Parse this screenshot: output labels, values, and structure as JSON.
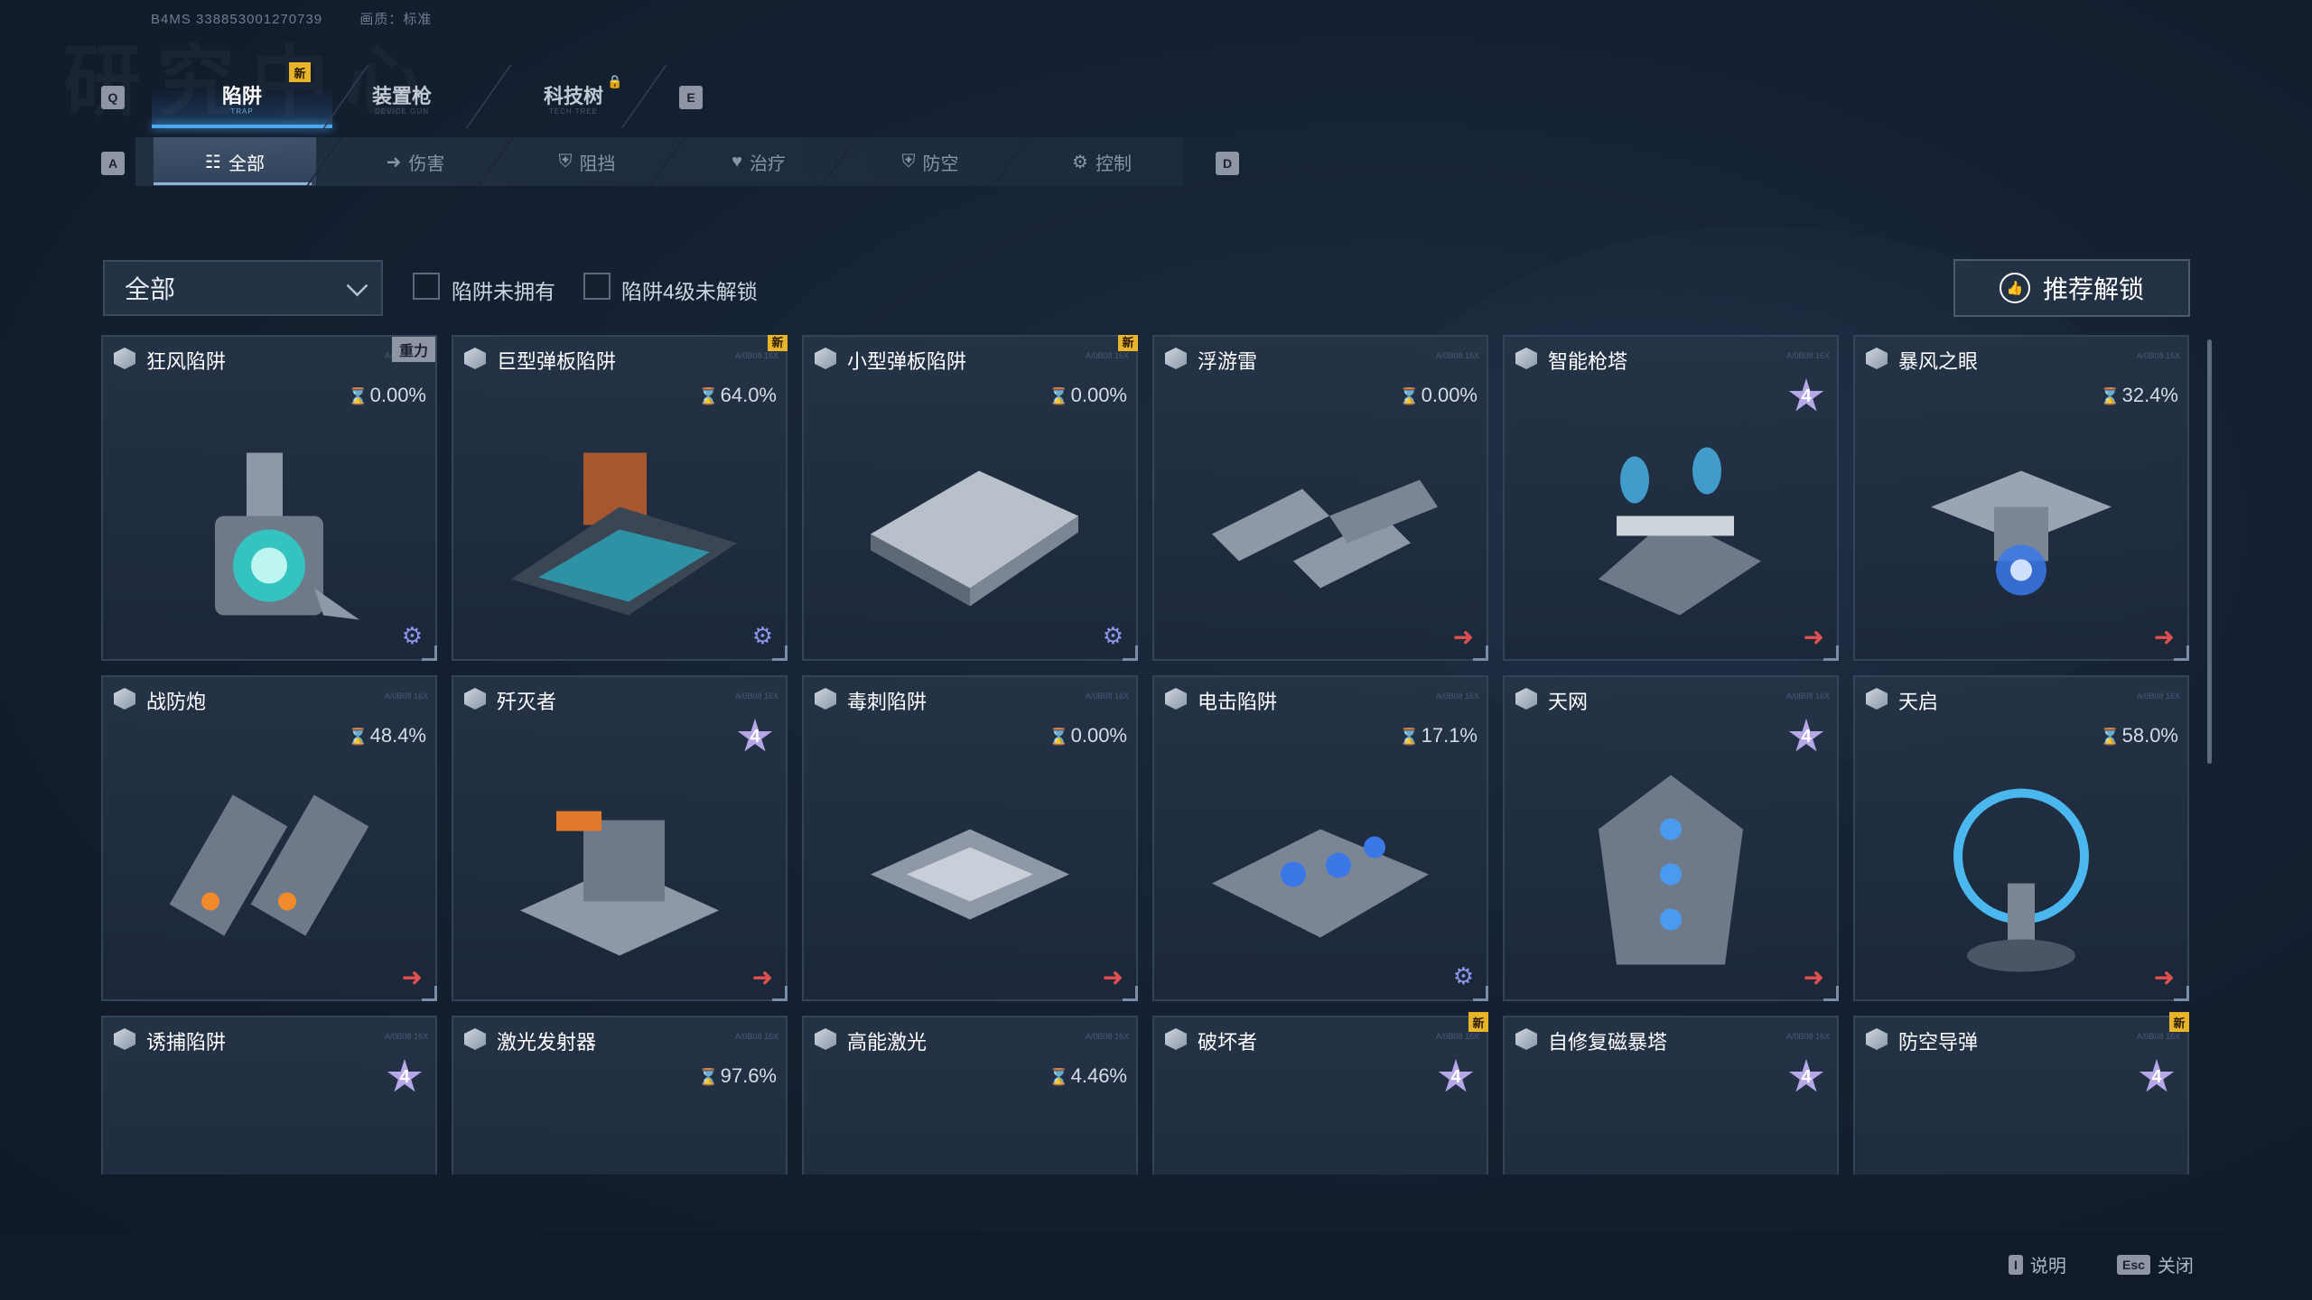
{
  "top_info": {
    "id": "B4MS 338853001270739",
    "quality": "画质：标准"
  },
  "main_tabs": [
    {
      "label": "陷阱",
      "sub": "TRAP"
    },
    {
      "label": "装置枪",
      "sub": "DEVICE GUN"
    },
    {
      "label": "科技树",
      "sub": "TECH TREE"
    }
  ],
  "new_badge": "新",
  "keys": {
    "prev_main": "Q",
    "next_main": "E",
    "prev_sub": "A",
    "next_sub": "D",
    "info": "I",
    "close": "Esc"
  },
  "sub_tabs": [
    {
      "label": "全部",
      "icon": "☷"
    },
    {
      "label": "伤害",
      "icon": "➜"
    },
    {
      "label": "阻挡",
      "icon": "⛨"
    },
    {
      "label": "治疗",
      "icon": "♥"
    },
    {
      "label": "防空",
      "icon": "⛨"
    },
    {
      "label": "控制",
      "icon": "⚙"
    }
  ],
  "filter": {
    "dropdown_value": "全部",
    "check1": "陷阱未拥有",
    "check2": "陷阱4级未解锁",
    "recommend": "推荐解锁"
  },
  "code_text": "A/0B08 16X",
  "cards": [
    {
      "name": "狂风陷阱",
      "progress": "0.00%",
      "tag": "重力",
      "new": false,
      "star": null,
      "action": "gear",
      "model": "core"
    },
    {
      "name": "巨型弹板陷阱",
      "progress": "64.0%",
      "tag": null,
      "new": true,
      "star": null,
      "action": "gear",
      "model": "padfire"
    },
    {
      "name": "小型弹板陷阱",
      "progress": "0.00%",
      "tag": null,
      "new": true,
      "star": null,
      "action": "gear",
      "model": "pad"
    },
    {
      "name": "浮游雷",
      "progress": "0.00%",
      "tag": null,
      "new": false,
      "star": null,
      "action": "arrow",
      "model": "mines"
    },
    {
      "name": "智能枪塔",
      "progress": null,
      "tag": null,
      "new": false,
      "star": "4",
      "action": "arrow",
      "model": "turret"
    },
    {
      "name": "暴风之眼",
      "progress": "32.4%",
      "tag": null,
      "new": false,
      "star": null,
      "action": "arrow",
      "model": "eye"
    },
    {
      "name": "战防炮",
      "progress": "48.4%",
      "tag": null,
      "new": false,
      "star": null,
      "action": "arrow",
      "model": "cannon"
    },
    {
      "name": "歼灭者",
      "progress": null,
      "tag": null,
      "new": false,
      "star": "4",
      "action": "arrow",
      "model": "tank"
    },
    {
      "name": "毒刺陷阱",
      "progress": "0.00%",
      "tag": null,
      "new": false,
      "star": null,
      "action": "arrow",
      "model": "spike"
    },
    {
      "name": "电击陷阱",
      "progress": "17.1%",
      "tag": null,
      "new": false,
      "star": null,
      "action": "gear",
      "model": "shock"
    },
    {
      "name": "天网",
      "progress": null,
      "tag": null,
      "new": false,
      "star": "4",
      "action": "arrow",
      "model": "net"
    },
    {
      "name": "天启",
      "progress": "58.0%",
      "tag": null,
      "new": false,
      "star": null,
      "action": "arrow",
      "model": "orb"
    },
    {
      "name": "诱捕陷阱",
      "progress": null,
      "tag": null,
      "new": false,
      "star": "4",
      "action": "none",
      "model": "bait"
    },
    {
      "name": "激光发射器",
      "progress": "97.6%",
      "tag": null,
      "new": false,
      "star": null,
      "action": "none",
      "model": "laser"
    },
    {
      "name": "高能激光",
      "progress": "4.46%",
      "tag": null,
      "new": false,
      "star": null,
      "action": "none",
      "model": "hlaser"
    },
    {
      "name": "破坏者",
      "progress": null,
      "tag": null,
      "new": true,
      "star": "4",
      "action": "none",
      "model": "wrecker"
    },
    {
      "name": "自修复磁暴塔",
      "progress": null,
      "tag": null,
      "new": false,
      "star": "4",
      "action": "none",
      "model": "tesla"
    },
    {
      "name": "防空导弹",
      "progress": null,
      "tag": null,
      "new": true,
      "star": "4",
      "action": "none",
      "model": "missile"
    }
  ],
  "bottom": {
    "info_label": "说明",
    "close_label": "关闭"
  },
  "colors": {
    "accent": "#4aa8f0",
    "new_badge": "#e8b52a",
    "star": "#b6a8e8",
    "arrow": "#e05050",
    "gear": "#8c94e8"
  }
}
